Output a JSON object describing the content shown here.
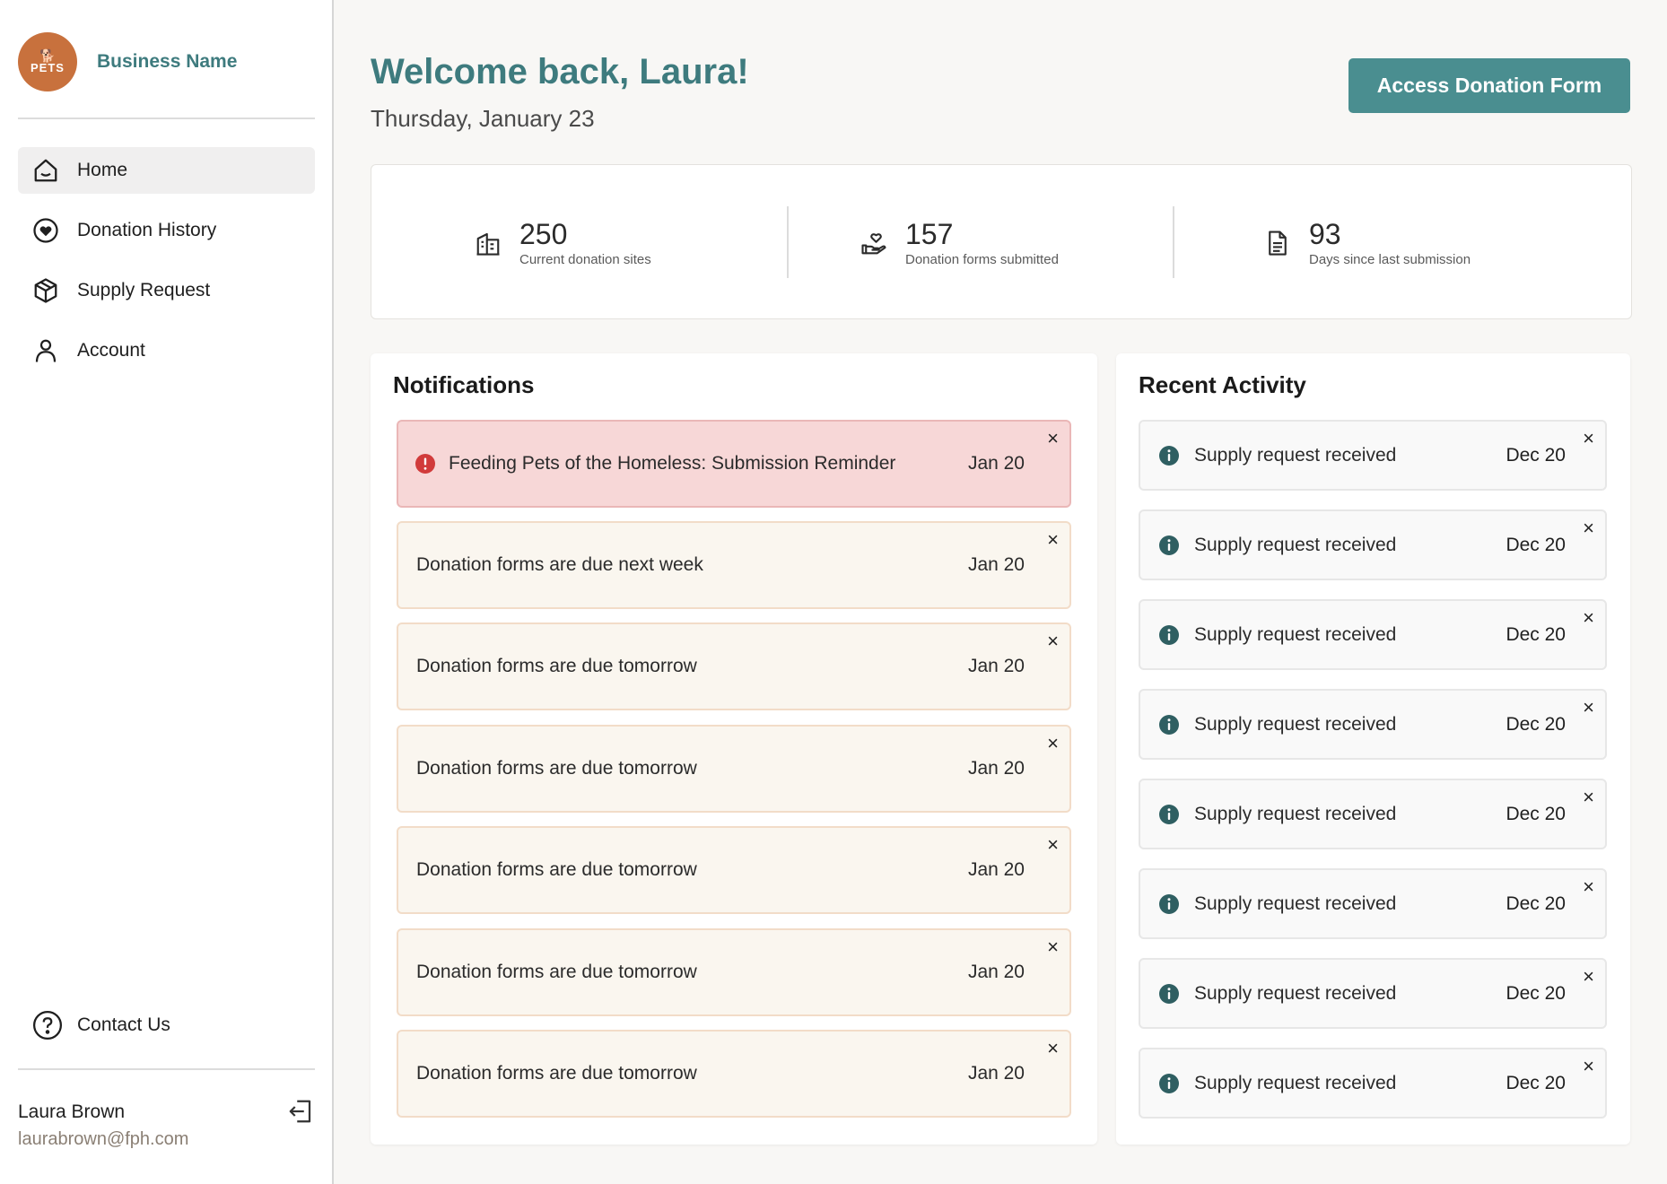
{
  "sidebar": {
    "brand_name": "Business Name",
    "logo_text": "PETS",
    "nav": [
      {
        "label": "Home",
        "icon": "home-icon",
        "active": true
      },
      {
        "label": "Donation History",
        "icon": "heart-circle-icon"
      },
      {
        "label": "Supply Request",
        "icon": "box-icon"
      },
      {
        "label": "Account",
        "icon": "user-icon"
      }
    ],
    "contact_label": "Contact Us",
    "user": {
      "name": "Laura Brown",
      "email": "laurabrown@fph.com"
    }
  },
  "header": {
    "welcome": "Welcome back, Laura!",
    "date": "Thursday, January 23",
    "cta_label": "Access Donation Form"
  },
  "stats": [
    {
      "value": "250",
      "label": "Current donation sites",
      "icon": "building-icon"
    },
    {
      "value": "157",
      "label": "Donation forms submitted",
      "icon": "hand-heart-icon"
    },
    {
      "value": "93",
      "label": "Days since last submission",
      "icon": "document-icon"
    }
  ],
  "notifications": {
    "title": "Notifications",
    "items": [
      {
        "text": "Feeding Pets of the Homeless: Submission Reminder",
        "date": "Jan 20",
        "type": "alert"
      },
      {
        "text": "Donation forms are due next week",
        "date": "Jan 20",
        "type": "normal"
      },
      {
        "text": "Donation forms are due tomorrow",
        "date": "Jan 20",
        "type": "normal"
      },
      {
        "text": "Donation forms are due tomorrow",
        "date": "Jan 20",
        "type": "normal"
      },
      {
        "text": "Donation forms are due tomorrow",
        "date": "Jan 20",
        "type": "normal"
      },
      {
        "text": "Donation forms are due tomorrow",
        "date": "Jan 20",
        "type": "normal"
      },
      {
        "text": "Donation forms are due tomorrow",
        "date": "Jan 20",
        "type": "normal"
      }
    ]
  },
  "activity": {
    "title": "Recent Activity",
    "items": [
      {
        "text": "Supply request received",
        "date": "Dec 20"
      },
      {
        "text": "Supply request received",
        "date": "Dec 20"
      },
      {
        "text": "Supply request received",
        "date": "Dec 20"
      },
      {
        "text": "Supply request received",
        "date": "Dec 20"
      },
      {
        "text": "Supply request received",
        "date": "Dec 20"
      },
      {
        "text": "Supply request received",
        "date": "Dec 20"
      },
      {
        "text": "Supply request received",
        "date": "Dec 20"
      },
      {
        "text": "Supply request received",
        "date": "Dec 20"
      }
    ]
  },
  "colors": {
    "accent": "#3e7b7e",
    "button": "#4a8e90",
    "alert_bg": "#f7d7d7",
    "alert_icon": "#d13b3b",
    "info_icon": "#2f5f62",
    "logo": "#c8713d"
  }
}
